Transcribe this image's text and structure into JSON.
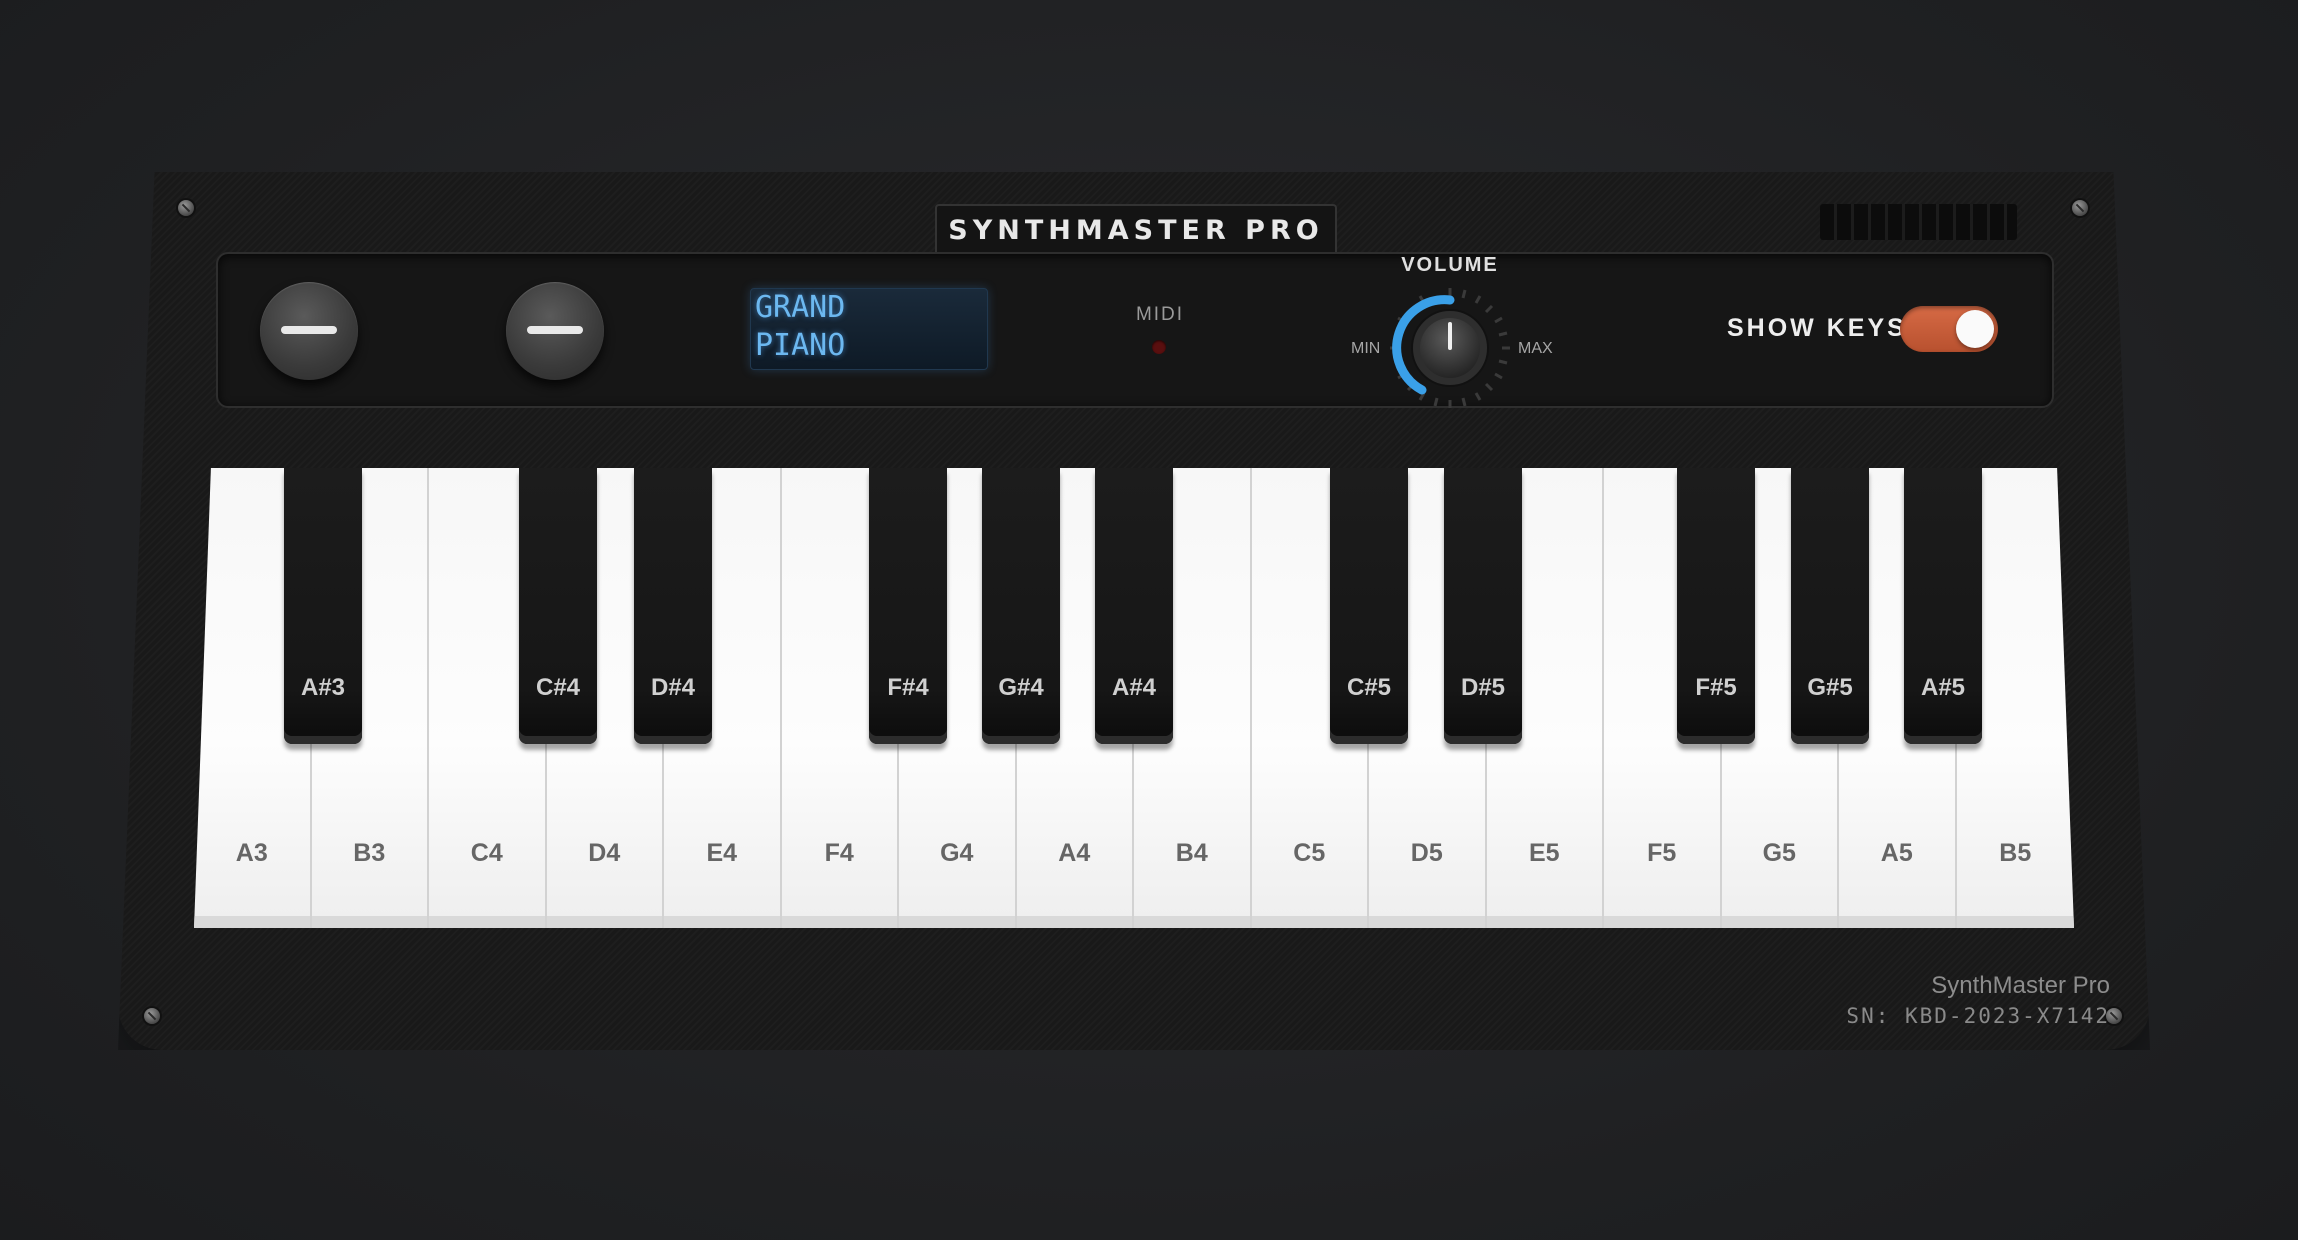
{
  "brand": {
    "title": "SYNTHMASTER PRO",
    "model": "SynthMaster Pro",
    "serial": "SN: KBD-2023-X7142"
  },
  "controls": {
    "lcd_line1": "GRAND",
    "lcd_line2": "PIANO",
    "midi_label": "MIDI",
    "volume_label": "VOLUME",
    "volume_min": "MIN",
    "volume_max": "MAX",
    "show_keys_label": "SHOW KEYS",
    "show_keys_on": true
  },
  "keyboard": {
    "white_keys": [
      "A3",
      "B3",
      "C4",
      "D4",
      "E4",
      "F4",
      "G4",
      "A4",
      "B4",
      "C5",
      "D5",
      "E5",
      "F5",
      "G5",
      "A5",
      "B5"
    ],
    "black_keys": [
      "A#3",
      "C#4",
      "D#4",
      "F#4",
      "G#4",
      "A#4",
      "C#5",
      "D#5",
      "F#5",
      "G#5",
      "A#5"
    ]
  },
  "colors": {
    "accent_knob": "#3aa0e8",
    "toggle_on": "#c85c38",
    "lcd_text": "#6cb8f0",
    "midi_led_off": "#5a0f0f"
  },
  "icons": {
    "minus_button": "minus-icon"
  }
}
